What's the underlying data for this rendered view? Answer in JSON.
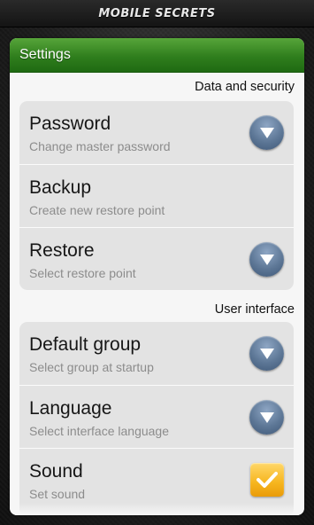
{
  "app": {
    "title": "MOBILE SECRETS"
  },
  "panel": {
    "title": "Settings"
  },
  "sections": [
    {
      "label": "Data and security",
      "items": [
        {
          "title": "Password",
          "subtitle": "Change master password",
          "control": "dropdown"
        },
        {
          "title": "Backup",
          "subtitle": "Create new restore point",
          "control": "none"
        },
        {
          "title": "Restore",
          "subtitle": "Select restore point",
          "control": "dropdown"
        }
      ]
    },
    {
      "label": "User interface",
      "items": [
        {
          "title": "Default group",
          "subtitle": "Select group at startup",
          "control": "dropdown"
        },
        {
          "title": "Language",
          "subtitle": "Select interface language",
          "control": "dropdown"
        },
        {
          "title": "Sound",
          "subtitle": "Set sound",
          "control": "checkbox",
          "checked": true
        }
      ]
    }
  ],
  "icons": {
    "dropdown": "chevron-down-icon",
    "checkbox": "checkmark-icon"
  },
  "colors": {
    "header_green": "#2f7e1d",
    "dropdown_blue": "#5d7796",
    "checkbox_orange": "#f6b51e"
  }
}
